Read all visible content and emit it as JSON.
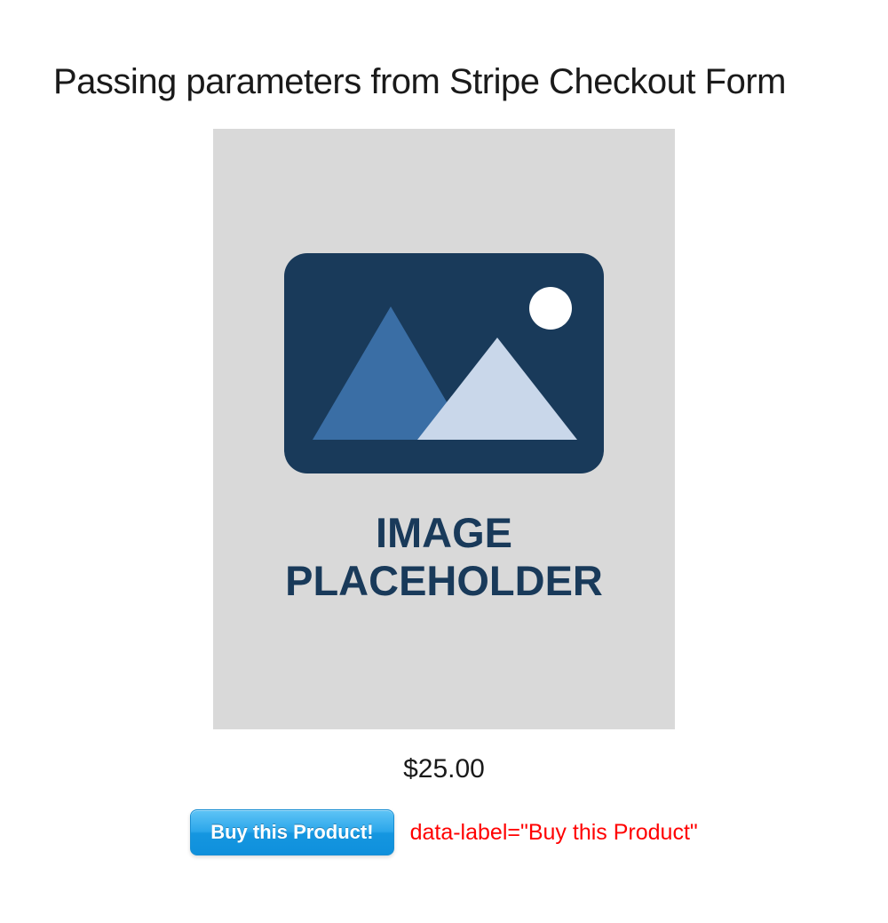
{
  "header": {
    "title": "Passing parameters from Stripe Checkout Form"
  },
  "product": {
    "placeholder_line1": "IMAGE",
    "placeholder_line2": "PLACEHOLDER",
    "price": "$25.00"
  },
  "actions": {
    "buy_label": "Buy this Product!"
  },
  "annotation": {
    "text": "data-label=\"Buy this Product\""
  }
}
